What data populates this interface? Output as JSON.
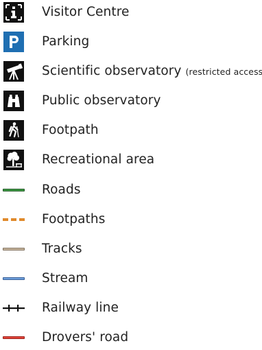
{
  "legend": {
    "items": [
      {
        "label": "Visitor Centre",
        "note": "",
        "symbol": "visitor-centre-icon",
        "color": "#111111"
      },
      {
        "label": "Parking",
        "note": "",
        "symbol": "parking-icon",
        "color": "#1f6fb2"
      },
      {
        "label": "Scientific observatory",
        "note": "(restricted access)",
        "symbol": "telescope-icon",
        "color": "#111111"
      },
      {
        "label": "Public observatory",
        "note": "",
        "symbol": "binoculars-icon",
        "color": "#111111"
      },
      {
        "label": "Footpath",
        "note": "",
        "symbol": "hiker-icon",
        "color": "#111111"
      },
      {
        "label": "Recreational area",
        "note": "",
        "symbol": "picnic-icon",
        "color": "#111111"
      },
      {
        "label": "Roads",
        "note": "",
        "symbol": "road-line",
        "color": "#2e7d32"
      },
      {
        "label": "Footpaths",
        "note": "",
        "symbol": "footpath-dashed-line",
        "color": "#e08a2c"
      },
      {
        "label": "Tracks",
        "note": "",
        "symbol": "track-line",
        "color": "#b9a58c"
      },
      {
        "label": "Stream",
        "note": "",
        "symbol": "stream-line",
        "color": "#5b8fd0"
      },
      {
        "label": "Railway line",
        "note": "",
        "symbol": "railway-line",
        "color": "#111111"
      },
      {
        "label": "Drovers' road",
        "note": "",
        "symbol": "drovers-road-line",
        "color": "#d33a2f"
      }
    ]
  }
}
